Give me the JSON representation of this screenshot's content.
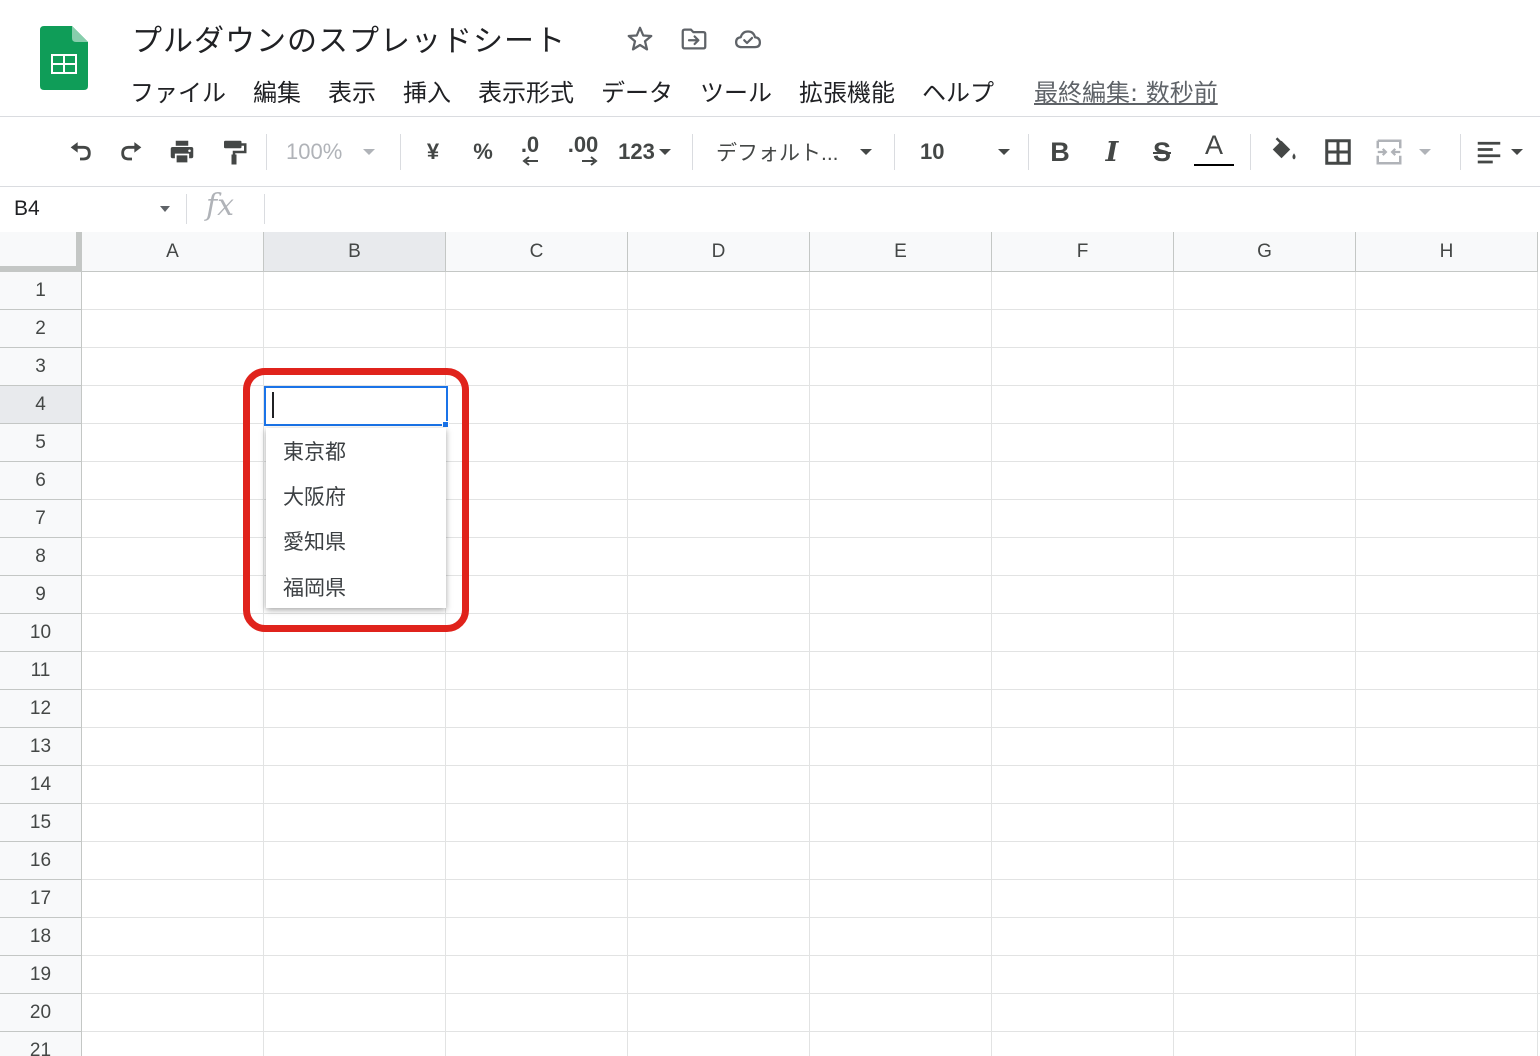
{
  "app": {
    "title": "プルダウンのスプレッドシート",
    "menu": [
      "ファイル",
      "編集",
      "表示",
      "挿入",
      "表示形式",
      "データ",
      "ツール",
      "拡張機能",
      "ヘルプ"
    ],
    "last_edit": "最終編集: 数秒前",
    "accent_color": "#1a73e8",
    "logo_color": "#0f9d58"
  },
  "toolbar": {
    "zoom": "100%",
    "currency": "¥",
    "percent": "%",
    "decrease_decimal": ".0",
    "increase_decimal": ".00",
    "number_format": "123",
    "font": "デフォルト...",
    "font_size": "10",
    "bold": "B",
    "italic": "I",
    "strikethrough": "S",
    "text_color_letter": "A",
    "icons": [
      "undo-icon",
      "redo-icon",
      "print-icon",
      "paint-format-icon",
      "fill-color-icon",
      "borders-icon",
      "merge-cells-icon",
      "align-icon"
    ]
  },
  "formula_bar": {
    "cell_ref": "B4",
    "fx": "fx",
    "value": ""
  },
  "grid": {
    "columns": [
      "A",
      "B",
      "C",
      "D",
      "E",
      "F",
      "G",
      "H"
    ],
    "rows": [
      "1",
      "2",
      "3",
      "4",
      "5",
      "6",
      "7",
      "8",
      "9",
      "10",
      "11",
      "12",
      "13",
      "14",
      "15",
      "16",
      "17",
      "18",
      "19",
      "20",
      "21"
    ],
    "selected_column": "B",
    "selected_row": "4"
  },
  "dropdown": {
    "options": [
      "東京都",
      "大阪府",
      "愛知県",
      "福岡県"
    ],
    "highlight_color": "#e0231c"
  }
}
